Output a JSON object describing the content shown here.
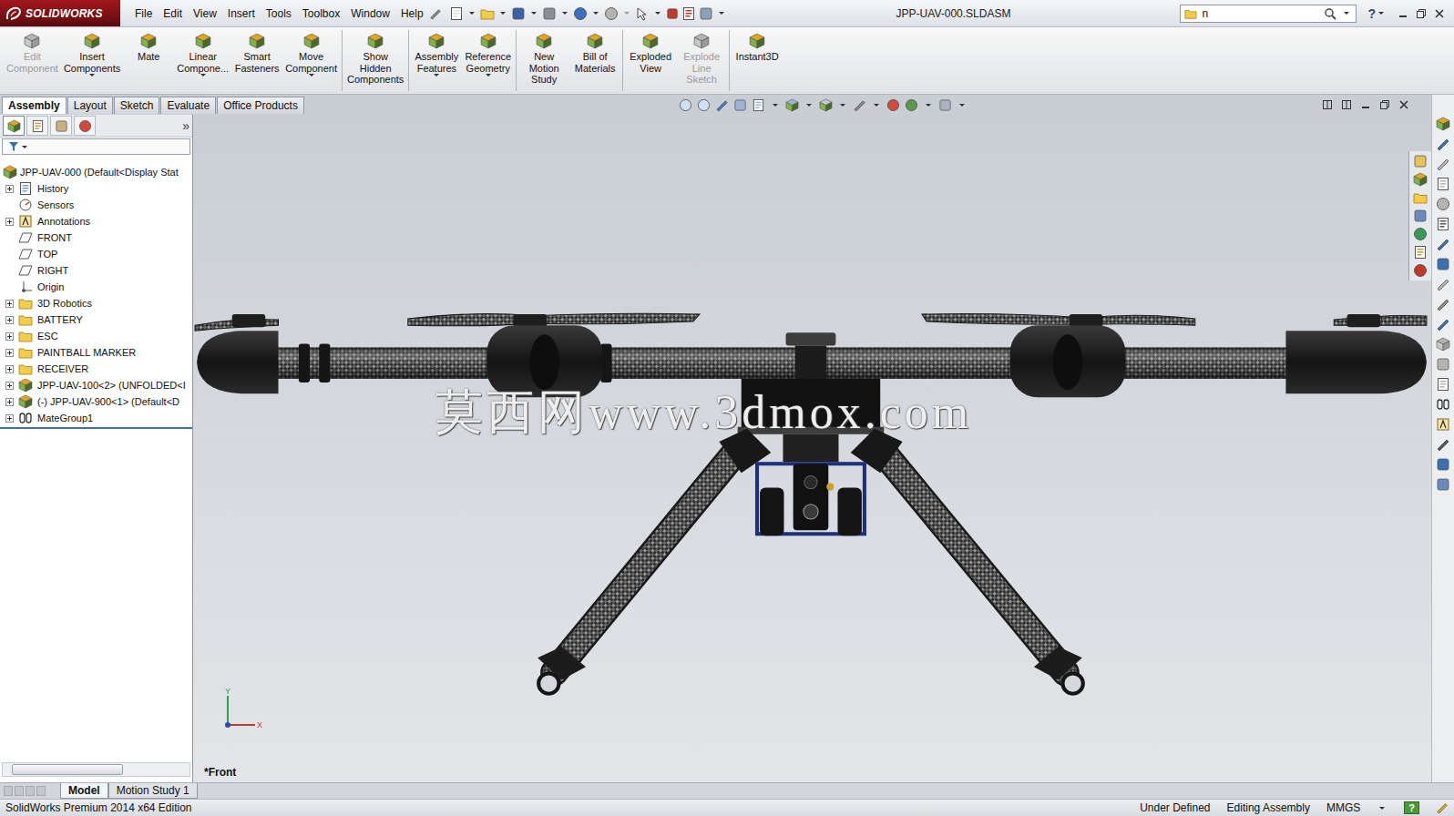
{
  "app": {
    "logo": "SOLIDWORKS",
    "menu": [
      "File",
      "Edit",
      "View",
      "Insert",
      "Tools",
      "Toolbox",
      "Window",
      "Help"
    ],
    "title": "JPP-UAV-000.SLDASM",
    "search": {
      "value": "n"
    },
    "help": "?"
  },
  "ribbon": {
    "groups": [
      [
        {
          "lines": [
            "Edit",
            "Component"
          ],
          "disabled": true,
          "dropdown": false
        },
        {
          "lines": [
            "Insert",
            "Components"
          ],
          "disabled": false,
          "dropdown": true
        },
        {
          "lines": [
            "Mate"
          ],
          "disabled": false,
          "dropdown": false
        },
        {
          "lines": [
            "Linear",
            "Compone..."
          ],
          "disabled": false,
          "dropdown": true
        },
        {
          "lines": [
            "Smart",
            "Fasteners"
          ],
          "disabled": false,
          "dropdown": false
        },
        {
          "lines": [
            "Move",
            "Component"
          ],
          "disabled": false,
          "dropdown": true
        }
      ],
      [
        {
          "lines": [
            "Show",
            "Hidden",
            "Components"
          ],
          "disabled": false,
          "dropdown": false
        }
      ],
      [
        {
          "lines": [
            "Assembly",
            "Features"
          ],
          "disabled": false,
          "dropdown": true
        },
        {
          "lines": [
            "Reference",
            "Geometry"
          ],
          "disabled": false,
          "dropdown": true
        }
      ],
      [
        {
          "lines": [
            "New",
            "Motion",
            "Study"
          ],
          "disabled": false,
          "dropdown": false
        },
        {
          "lines": [
            "Bill of",
            "Materials"
          ],
          "disabled": false,
          "dropdown": false
        }
      ],
      [
        {
          "lines": [
            "Exploded",
            "View"
          ],
          "disabled": false,
          "dropdown": false
        },
        {
          "lines": [
            "Explode",
            "Line",
            "Sketch"
          ],
          "disabled": true,
          "dropdown": false
        }
      ],
      [
        {
          "lines": [
            "Instant3D"
          ],
          "disabled": false,
          "dropdown": false
        }
      ]
    ]
  },
  "tabs": [
    {
      "label": "Assembly",
      "selected": true
    },
    {
      "label": "Layout",
      "selected": false
    },
    {
      "label": "Sketch",
      "selected": false
    },
    {
      "label": "Evaluate",
      "selected": false
    },
    {
      "label": "Office Products",
      "selected": false
    }
  ],
  "panel": {
    "chevron": "»",
    "tree": [
      {
        "label": "JPP-UAV-000  (Default<Display Stat",
        "kind": "assembly",
        "depth": 0,
        "collapsed": false
      },
      {
        "label": "History",
        "kind": "history",
        "depth": 1,
        "collapsed": true
      },
      {
        "label": "Sensors",
        "kind": "sensor",
        "depth": 1,
        "collapsed": false
      },
      {
        "label": "Annotations",
        "kind": "annotation",
        "depth": 1,
        "collapsed": true
      },
      {
        "label": "FRONT",
        "kind": "plane",
        "depth": 1,
        "collapsed": false
      },
      {
        "label": "TOP",
        "kind": "plane",
        "depth": 1,
        "collapsed": false
      },
      {
        "label": "RIGHT",
        "kind": "plane",
        "depth": 1,
        "collapsed": false
      },
      {
        "label": "Origin",
        "kind": "origin",
        "depth": 1,
        "collapsed": false
      },
      {
        "label": "3D Robotics",
        "kind": "folder",
        "depth": 1,
        "collapsed": true
      },
      {
        "label": "BATTERY",
        "kind": "folder",
        "depth": 1,
        "collapsed": true
      },
      {
        "label": "ESC",
        "kind": "folder",
        "depth": 1,
        "collapsed": true
      },
      {
        "label": "PAINTBALL MARKER",
        "kind": "folder",
        "depth": 1,
        "collapsed": true
      },
      {
        "label": "RECEIVER",
        "kind": "folder",
        "depth": 1,
        "collapsed": true
      },
      {
        "label": "JPP-UAV-100<2> (UNFOLDED<I",
        "kind": "subassembly",
        "depth": 1,
        "collapsed": true
      },
      {
        "label": "(-) JPP-UAV-900<1> (Default<D",
        "kind": "subassembly",
        "depth": 1,
        "collapsed": true
      },
      {
        "label": "MateGroup1",
        "kind": "mates",
        "depth": 1,
        "collapsed": true
      }
    ]
  },
  "viewport": {
    "watermark": "莫西网www.3dmox.com",
    "view_label": "*Front",
    "triad": {
      "x": "X",
      "y": "Y"
    }
  },
  "bottom_tabs": [
    {
      "label": "Model",
      "selected": true
    },
    {
      "label": "Motion Study 1",
      "selected": false
    }
  ],
  "status_bar": {
    "edition": "SolidWorks Premium 2014 x64 Edition",
    "state": "Under Defined",
    "mode": "Editing Assembly",
    "units": "MMGS",
    "help": "?"
  }
}
